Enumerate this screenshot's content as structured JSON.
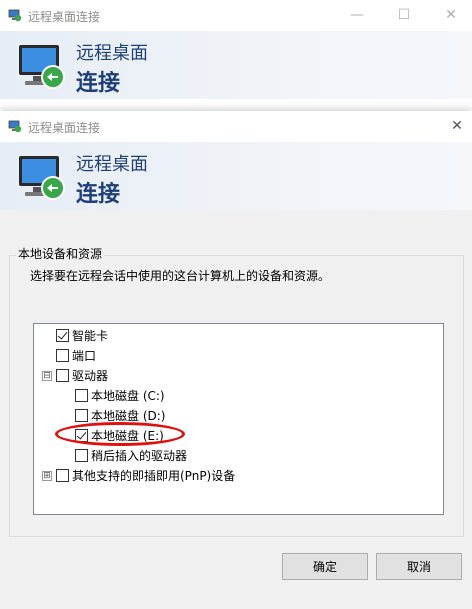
{
  "bg_window": {
    "title": "远程桌面连接",
    "banner_line1": "远程桌面",
    "banner_line2": "连接"
  },
  "dialog": {
    "title": "远程桌面连接",
    "banner_line1": "远程桌面",
    "banner_line2": "连接",
    "group_title": "本地设备和资源",
    "description": "选择要在远程会话中使用的这台计算机上的设备和资源。",
    "tree": [
      {
        "label": "智能卡",
        "checked": true
      },
      {
        "label": "端口",
        "checked": false
      },
      {
        "label": "驱动器",
        "checked": false,
        "expander": "⊟"
      },
      {
        "label": "本地磁盘 (C:)",
        "checked": false
      },
      {
        "label": "本地磁盘 (D:)",
        "checked": false
      },
      {
        "label": "本地磁盘 (E:)",
        "checked": true
      },
      {
        "label": "稍后插入的驱动器",
        "checked": false
      },
      {
        "label": "其他支持的即插即用(PnP)设备",
        "checked": false,
        "expander": "⊞"
      }
    ],
    "ok_label": "确定",
    "cancel_label": "取消"
  },
  "icons": {
    "minimize": "minimize-icon",
    "maximize": "maximize-icon",
    "close": "close-icon",
    "app": "remote-desktop-icon"
  },
  "colors": {
    "banner_text": "#1f3f7a",
    "highlight_ellipse": "#e01010"
  }
}
